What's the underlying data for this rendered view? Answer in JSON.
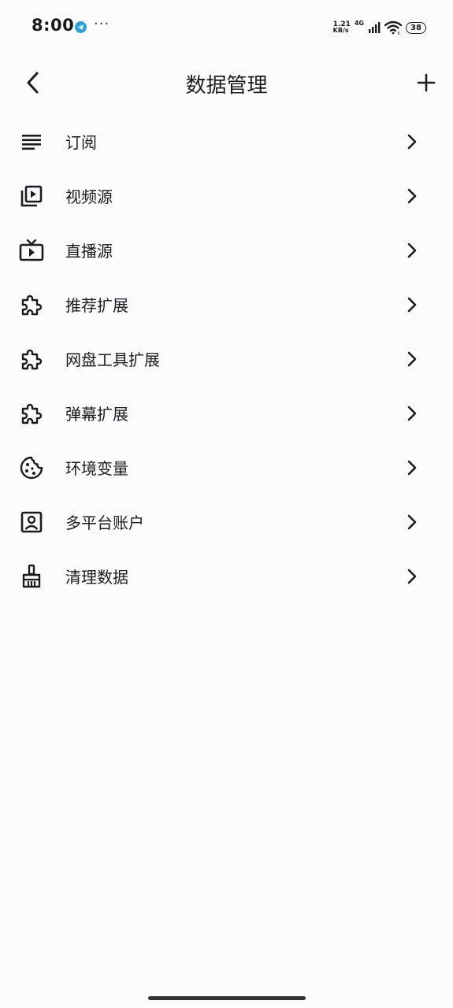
{
  "status_bar": {
    "time": "8:00",
    "more": "···",
    "net_speed_value": "1.21",
    "net_speed_unit": "KB/s",
    "net_type": "4G",
    "battery": "38"
  },
  "app_bar": {
    "title": "数据管理",
    "back_icon": "chevron-left-icon",
    "add_icon": "plus-icon"
  },
  "menu": {
    "items": [
      {
        "label": "订阅",
        "icon": "list-lines-icon"
      },
      {
        "label": "视频源",
        "icon": "video-library-icon"
      },
      {
        "label": "直播源",
        "icon": "live-tv-icon"
      },
      {
        "label": "推荐扩展",
        "icon": "puzzle-icon"
      },
      {
        "label": "网盘工具扩展",
        "icon": "puzzle-icon"
      },
      {
        "label": "弹幕扩展",
        "icon": "puzzle-icon"
      },
      {
        "label": "环境变量",
        "icon": "cookie-icon"
      },
      {
        "label": "多平台账户",
        "icon": "account-box-icon"
      },
      {
        "label": "清理数据",
        "icon": "broom-icon"
      }
    ]
  },
  "colors": {
    "background": "#fdfbfc",
    "text": "#1c1b1f",
    "telegram": "#2aa1da"
  }
}
